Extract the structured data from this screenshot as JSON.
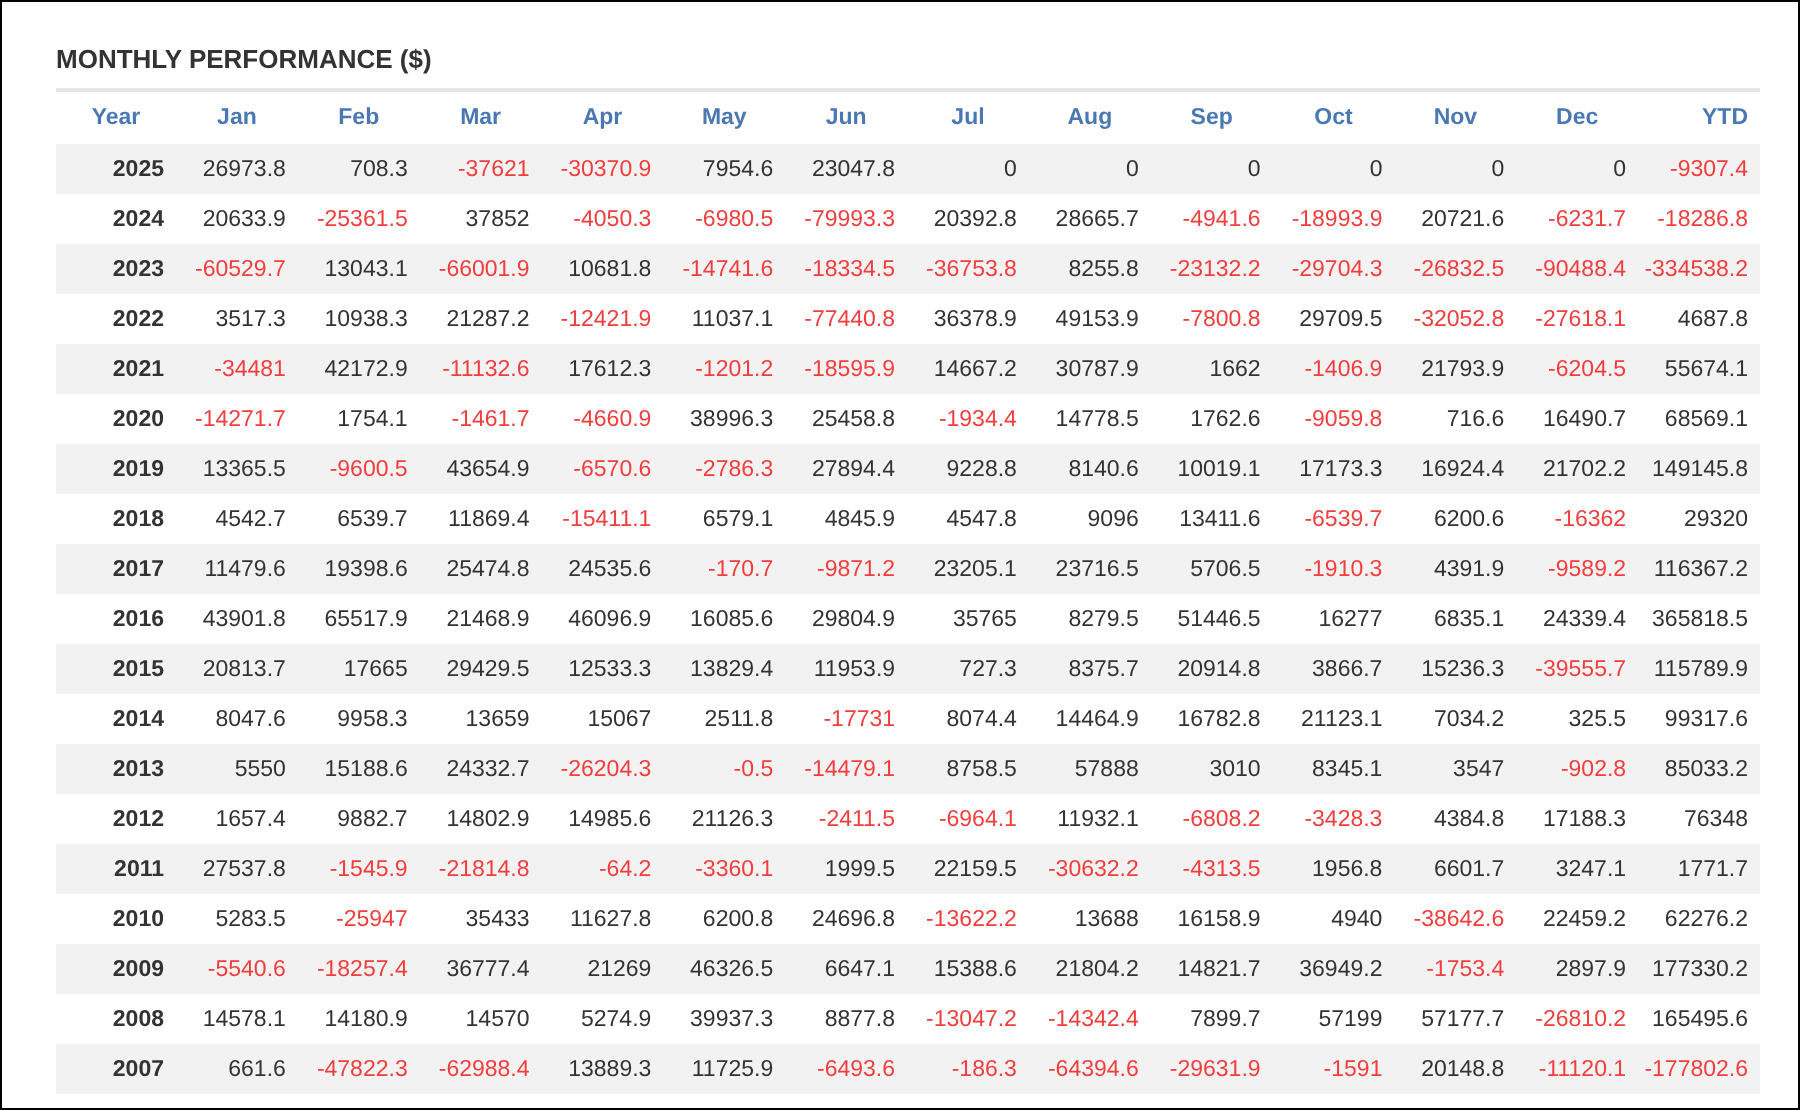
{
  "title": "MONTHLY PERFORMANCE ($)",
  "columns": [
    "Year",
    "Jan",
    "Feb",
    "Mar",
    "Apr",
    "May",
    "Jun",
    "Jul",
    "Aug",
    "Sep",
    "Oct",
    "Nov",
    "Dec",
    "YTD"
  ],
  "rows": [
    {
      "year": "2025",
      "cells": [
        {
          "v": "26973.8",
          "negative": false
        },
        {
          "v": "708.3",
          "negative": false
        },
        {
          "v": "-37621",
          "negative": true
        },
        {
          "v": "-30370.9",
          "negative": true
        },
        {
          "v": "7954.6",
          "negative": false
        },
        {
          "v": "23047.8",
          "negative": false
        },
        {
          "v": "0",
          "negative": false
        },
        {
          "v": "0",
          "negative": false
        },
        {
          "v": "0",
          "negative": false
        },
        {
          "v": "0",
          "negative": false
        },
        {
          "v": "0",
          "negative": false
        },
        {
          "v": "0",
          "negative": false
        },
        {
          "v": "-9307.4",
          "negative": true
        }
      ]
    },
    {
      "year": "2024",
      "cells": [
        {
          "v": "20633.9",
          "negative": false
        },
        {
          "v": "-25361.5",
          "negative": true
        },
        {
          "v": "37852",
          "negative": false
        },
        {
          "v": "-4050.3",
          "negative": true
        },
        {
          "v": "-6980.5",
          "negative": true
        },
        {
          "v": "-79993.3",
          "negative": true
        },
        {
          "v": "20392.8",
          "negative": false
        },
        {
          "v": "28665.7",
          "negative": false
        },
        {
          "v": "-4941.6",
          "negative": true
        },
        {
          "v": "-18993.9",
          "negative": true
        },
        {
          "v": "20721.6",
          "negative": false
        },
        {
          "v": "-6231.7",
          "negative": true
        },
        {
          "v": "-18286.8",
          "negative": true
        }
      ]
    },
    {
      "year": "2023",
      "cells": [
        {
          "v": "-60529.7",
          "negative": true
        },
        {
          "v": "13043.1",
          "negative": false
        },
        {
          "v": "-66001.9",
          "negative": true
        },
        {
          "v": "10681.8",
          "negative": false
        },
        {
          "v": "-14741.6",
          "negative": true
        },
        {
          "v": "-18334.5",
          "negative": true
        },
        {
          "v": "-36753.8",
          "negative": true
        },
        {
          "v": "8255.8",
          "negative": false
        },
        {
          "v": "-23132.2",
          "negative": true
        },
        {
          "v": "-29704.3",
          "negative": true
        },
        {
          "v": "-26832.5",
          "negative": true
        },
        {
          "v": "-90488.4",
          "negative": true
        },
        {
          "v": "-334538.2",
          "negative": true
        }
      ]
    },
    {
      "year": "2022",
      "cells": [
        {
          "v": "3517.3",
          "negative": false
        },
        {
          "v": "10938.3",
          "negative": false
        },
        {
          "v": "21287.2",
          "negative": false
        },
        {
          "v": "-12421.9",
          "negative": true
        },
        {
          "v": "11037.1",
          "negative": false
        },
        {
          "v": "-77440.8",
          "negative": true
        },
        {
          "v": "36378.9",
          "negative": false
        },
        {
          "v": "49153.9",
          "negative": false
        },
        {
          "v": "-7800.8",
          "negative": true
        },
        {
          "v": "29709.5",
          "negative": false
        },
        {
          "v": "-32052.8",
          "negative": true
        },
        {
          "v": "-27618.1",
          "negative": true
        },
        {
          "v": "4687.8",
          "negative": false
        }
      ]
    },
    {
      "year": "2021",
      "cells": [
        {
          "v": "-34481",
          "negative": true
        },
        {
          "v": "42172.9",
          "negative": false
        },
        {
          "v": "-11132.6",
          "negative": true
        },
        {
          "v": "17612.3",
          "negative": false
        },
        {
          "v": "-1201.2",
          "negative": true
        },
        {
          "v": "-18595.9",
          "negative": true
        },
        {
          "v": "14667.2",
          "negative": false
        },
        {
          "v": "30787.9",
          "negative": false
        },
        {
          "v": "1662",
          "negative": false
        },
        {
          "v": "-1406.9",
          "negative": true
        },
        {
          "v": "21793.9",
          "negative": false
        },
        {
          "v": "-6204.5",
          "negative": true
        },
        {
          "v": "55674.1",
          "negative": false
        }
      ]
    },
    {
      "year": "2020",
      "cells": [
        {
          "v": "-14271.7",
          "negative": true
        },
        {
          "v": "1754.1",
          "negative": false
        },
        {
          "v": "-1461.7",
          "negative": true
        },
        {
          "v": "-4660.9",
          "negative": true
        },
        {
          "v": "38996.3",
          "negative": false
        },
        {
          "v": "25458.8",
          "negative": false
        },
        {
          "v": "-1934.4",
          "negative": true
        },
        {
          "v": "14778.5",
          "negative": false
        },
        {
          "v": "1762.6",
          "negative": false
        },
        {
          "v": "-9059.8",
          "negative": true
        },
        {
          "v": "716.6",
          "negative": false
        },
        {
          "v": "16490.7",
          "negative": false
        },
        {
          "v": "68569.1",
          "negative": false
        }
      ]
    },
    {
      "year": "2019",
      "cells": [
        {
          "v": "13365.5",
          "negative": false
        },
        {
          "v": "-9600.5",
          "negative": true
        },
        {
          "v": "43654.9",
          "negative": false
        },
        {
          "v": "-6570.6",
          "negative": true
        },
        {
          "v": "-2786.3",
          "negative": true
        },
        {
          "v": "27894.4",
          "negative": false
        },
        {
          "v": "9228.8",
          "negative": false
        },
        {
          "v": "8140.6",
          "negative": false
        },
        {
          "v": "10019.1",
          "negative": false
        },
        {
          "v": "17173.3",
          "negative": false
        },
        {
          "v": "16924.4",
          "negative": false
        },
        {
          "v": "21702.2",
          "negative": false
        },
        {
          "v": "149145.8",
          "negative": false
        }
      ]
    },
    {
      "year": "2018",
      "cells": [
        {
          "v": "4542.7",
          "negative": false
        },
        {
          "v": "6539.7",
          "negative": false
        },
        {
          "v": "11869.4",
          "negative": false
        },
        {
          "v": "-15411.1",
          "negative": true
        },
        {
          "v": "6579.1",
          "negative": false
        },
        {
          "v": "4845.9",
          "negative": false
        },
        {
          "v": "4547.8",
          "negative": false
        },
        {
          "v": "9096",
          "negative": false
        },
        {
          "v": "13411.6",
          "negative": false
        },
        {
          "v": "-6539.7",
          "negative": true
        },
        {
          "v": "6200.6",
          "negative": false
        },
        {
          "v": "-16362",
          "negative": true
        },
        {
          "v": "29320",
          "negative": false
        }
      ]
    },
    {
      "year": "2017",
      "cells": [
        {
          "v": "11479.6",
          "negative": false
        },
        {
          "v": "19398.6",
          "negative": false
        },
        {
          "v": "25474.8",
          "negative": false
        },
        {
          "v": "24535.6",
          "negative": false
        },
        {
          "v": "-170.7",
          "negative": true
        },
        {
          "v": "-9871.2",
          "negative": true
        },
        {
          "v": "23205.1",
          "negative": false
        },
        {
          "v": "23716.5",
          "negative": false
        },
        {
          "v": "5706.5",
          "negative": false
        },
        {
          "v": "-1910.3",
          "negative": true
        },
        {
          "v": "4391.9",
          "negative": false
        },
        {
          "v": "-9589.2",
          "negative": true
        },
        {
          "v": "116367.2",
          "negative": false
        }
      ]
    },
    {
      "year": "2016",
      "cells": [
        {
          "v": "43901.8",
          "negative": false
        },
        {
          "v": "65517.9",
          "negative": false
        },
        {
          "v": "21468.9",
          "negative": false
        },
        {
          "v": "46096.9",
          "negative": false
        },
        {
          "v": "16085.6",
          "negative": false
        },
        {
          "v": "29804.9",
          "negative": false
        },
        {
          "v": "35765",
          "negative": false
        },
        {
          "v": "8279.5",
          "negative": false
        },
        {
          "v": "51446.5",
          "negative": false
        },
        {
          "v": "16277",
          "negative": false
        },
        {
          "v": "6835.1",
          "negative": false
        },
        {
          "v": "24339.4",
          "negative": false
        },
        {
          "v": "365818.5",
          "negative": false
        }
      ]
    },
    {
      "year": "2015",
      "cells": [
        {
          "v": "20813.7",
          "negative": false
        },
        {
          "v": "17665",
          "negative": false
        },
        {
          "v": "29429.5",
          "negative": false
        },
        {
          "v": "12533.3",
          "negative": false
        },
        {
          "v": "13829.4",
          "negative": false
        },
        {
          "v": "11953.9",
          "negative": false
        },
        {
          "v": "727.3",
          "negative": false
        },
        {
          "v": "8375.7",
          "negative": false
        },
        {
          "v": "20914.8",
          "negative": false
        },
        {
          "v": "3866.7",
          "negative": false
        },
        {
          "v": "15236.3",
          "negative": false
        },
        {
          "v": "-39555.7",
          "negative": true
        },
        {
          "v": "115789.9",
          "negative": false
        }
      ]
    },
    {
      "year": "2014",
      "cells": [
        {
          "v": "8047.6",
          "negative": false
        },
        {
          "v": "9958.3",
          "negative": false
        },
        {
          "v": "13659",
          "negative": false
        },
        {
          "v": "15067",
          "negative": false
        },
        {
          "v": "2511.8",
          "negative": false
        },
        {
          "v": "-17731",
          "negative": true
        },
        {
          "v": "8074.4",
          "negative": false
        },
        {
          "v": "14464.9",
          "negative": false
        },
        {
          "v": "16782.8",
          "negative": false
        },
        {
          "v": "21123.1",
          "negative": false
        },
        {
          "v": "7034.2",
          "negative": false
        },
        {
          "v": "325.5",
          "negative": false
        },
        {
          "v": "99317.6",
          "negative": false
        }
      ]
    },
    {
      "year": "2013",
      "cells": [
        {
          "v": "5550",
          "negative": false
        },
        {
          "v": "15188.6",
          "negative": false
        },
        {
          "v": "24332.7",
          "negative": false
        },
        {
          "v": "-26204.3",
          "negative": true
        },
        {
          "v": "-0.5",
          "negative": true
        },
        {
          "v": "-14479.1",
          "negative": true
        },
        {
          "v": "8758.5",
          "negative": false
        },
        {
          "v": "57888",
          "negative": false
        },
        {
          "v": "3010",
          "negative": false
        },
        {
          "v": "8345.1",
          "negative": false
        },
        {
          "v": "3547",
          "negative": false
        },
        {
          "v": "-902.8",
          "negative": true
        },
        {
          "v": "85033.2",
          "negative": false
        }
      ]
    },
    {
      "year": "2012",
      "cells": [
        {
          "v": "1657.4",
          "negative": false
        },
        {
          "v": "9882.7",
          "negative": false
        },
        {
          "v": "14802.9",
          "negative": false
        },
        {
          "v": "14985.6",
          "negative": false
        },
        {
          "v": "21126.3",
          "negative": false
        },
        {
          "v": "-2411.5",
          "negative": true
        },
        {
          "v": "-6964.1",
          "negative": true
        },
        {
          "v": "11932.1",
          "negative": false
        },
        {
          "v": "-6808.2",
          "negative": true
        },
        {
          "v": "-3428.3",
          "negative": true
        },
        {
          "v": "4384.8",
          "negative": false
        },
        {
          "v": "17188.3",
          "negative": false
        },
        {
          "v": "76348",
          "negative": false
        }
      ]
    },
    {
      "year": "2011",
      "cells": [
        {
          "v": "27537.8",
          "negative": false
        },
        {
          "v": "-1545.9",
          "negative": true
        },
        {
          "v": "-21814.8",
          "negative": true
        },
        {
          "v": "-64.2",
          "negative": true
        },
        {
          "v": "-3360.1",
          "negative": true
        },
        {
          "v": "1999.5",
          "negative": false
        },
        {
          "v": "22159.5",
          "negative": false
        },
        {
          "v": "-30632.2",
          "negative": true
        },
        {
          "v": "-4313.5",
          "negative": true
        },
        {
          "v": "1956.8",
          "negative": false
        },
        {
          "v": "6601.7",
          "negative": false
        },
        {
          "v": "3247.1",
          "negative": false
        },
        {
          "v": "1771.7",
          "negative": false
        }
      ]
    },
    {
      "year": "2010",
      "cells": [
        {
          "v": "5283.5",
          "negative": false
        },
        {
          "v": "-25947",
          "negative": true
        },
        {
          "v": "35433",
          "negative": false
        },
        {
          "v": "11627.8",
          "negative": false
        },
        {
          "v": "6200.8",
          "negative": false
        },
        {
          "v": "24696.8",
          "negative": false
        },
        {
          "v": "-13622.2",
          "negative": true
        },
        {
          "v": "13688",
          "negative": false
        },
        {
          "v": "16158.9",
          "negative": false
        },
        {
          "v": "4940",
          "negative": false
        },
        {
          "v": "-38642.6",
          "negative": true
        },
        {
          "v": "22459.2",
          "negative": false
        },
        {
          "v": "62276.2",
          "negative": false
        }
      ]
    },
    {
      "year": "2009",
      "cells": [
        {
          "v": "-5540.6",
          "negative": true
        },
        {
          "v": "-18257.4",
          "negative": true
        },
        {
          "v": "36777.4",
          "negative": false
        },
        {
          "v": "21269",
          "negative": false
        },
        {
          "v": "46326.5",
          "negative": false
        },
        {
          "v": "6647.1",
          "negative": false
        },
        {
          "v": "15388.6",
          "negative": false
        },
        {
          "v": "21804.2",
          "negative": false
        },
        {
          "v": "14821.7",
          "negative": false
        },
        {
          "v": "36949.2",
          "negative": false
        },
        {
          "v": "-1753.4",
          "negative": true
        },
        {
          "v": "2897.9",
          "negative": false
        },
        {
          "v": "177330.2",
          "negative": false
        }
      ]
    },
    {
      "year": "2008",
      "cells": [
        {
          "v": "14578.1",
          "negative": false
        },
        {
          "v": "14180.9",
          "negative": false
        },
        {
          "v": "14570",
          "negative": false
        },
        {
          "v": "5274.9",
          "negative": false
        },
        {
          "v": "39937.3",
          "negative": false
        },
        {
          "v": "8877.8",
          "negative": false
        },
        {
          "v": "-13047.2",
          "negative": true
        },
        {
          "v": "-14342.4",
          "negative": true
        },
        {
          "v": "7899.7",
          "negative": false
        },
        {
          "v": "57199",
          "negative": false
        },
        {
          "v": "57177.7",
          "negative": false
        },
        {
          "v": "-26810.2",
          "negative": true
        },
        {
          "v": "165495.6",
          "negative": false
        }
      ]
    },
    {
      "year": "2007",
      "cells": [
        {
          "v": "661.6",
          "negative": false
        },
        {
          "v": "-47822.3",
          "negative": true
        },
        {
          "v": "-62988.4",
          "negative": true
        },
        {
          "v": "13889.3",
          "negative": false
        },
        {
          "v": "11725.9",
          "negative": false
        },
        {
          "v": "-6493.6",
          "negative": true
        },
        {
          "v": "-186.3",
          "negative": true
        },
        {
          "v": "-64394.6",
          "negative": true
        },
        {
          "v": "-29631.9",
          "negative": true
        },
        {
          "v": "-1591",
          "negative": true
        },
        {
          "v": "20148.8",
          "negative": false
        },
        {
          "v": "-11120.1",
          "negative": true
        },
        {
          "v": "-177802.6",
          "negative": true
        }
      ]
    }
  ]
}
